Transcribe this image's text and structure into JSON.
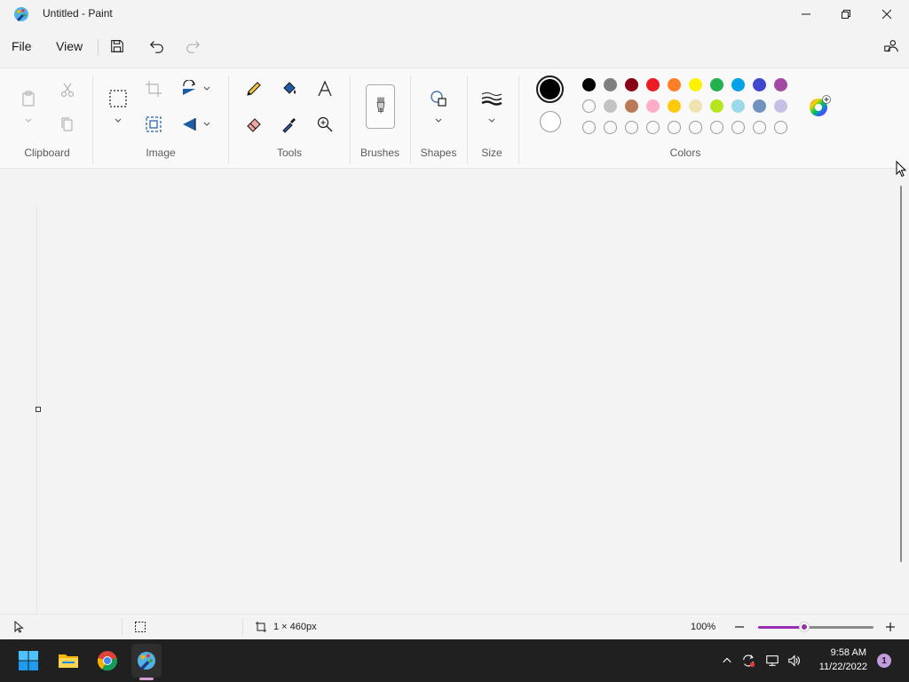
{
  "window": {
    "title": "Untitled - Paint"
  },
  "menu": {
    "file": "File",
    "view": "View"
  },
  "ribbon": {
    "groups": {
      "clipboard": "Clipboard",
      "image": "Image",
      "tools": "Tools",
      "brushes": "Brushes",
      "shapes": "Shapes",
      "size": "Size",
      "colors": "Colors"
    },
    "palette_row1": [
      "#000000",
      "#7f7f7f",
      "#880015",
      "#ed1c24",
      "#ff7f27",
      "#fff200",
      "#22b14c",
      "#00a2e8",
      "#3f48cc",
      "#a349a4"
    ],
    "palette_row2": [
      "",
      "#c3c3c3",
      "#b97a57",
      "#ffaec9",
      "#ffc90e",
      "#efe4b0",
      "#b5e61d",
      "#99d9ea",
      "#7092be",
      "#c8bfe7"
    ],
    "palette_row3": [
      "",
      "",
      "",
      "",
      "",
      "",
      "",
      "",
      "",
      ""
    ],
    "primary_color": "#000000",
    "secondary_color": "#ffffff"
  },
  "statusbar": {
    "canvas_size": "1 × 460px",
    "zoom": "100%",
    "zoom_level": 0.4
  },
  "taskbar": {
    "time": "9:58 AM",
    "date": "11/22/2022",
    "notifications": "1"
  }
}
